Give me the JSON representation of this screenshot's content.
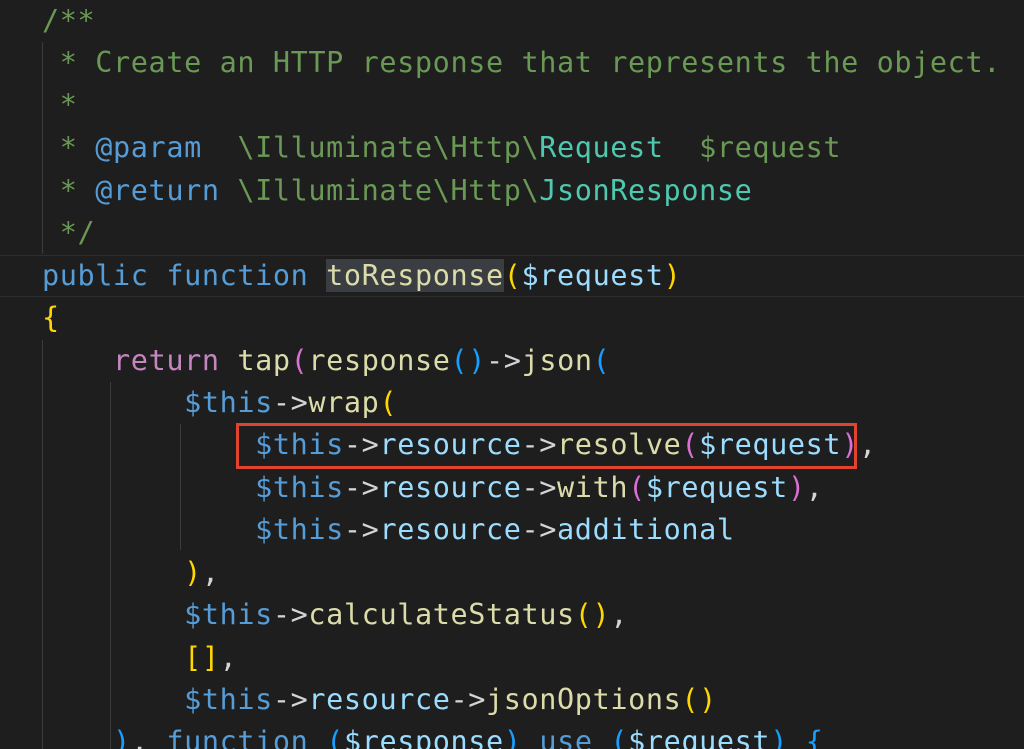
{
  "code": {
    "doc_open": "/**",
    "doc_line1": " * Create an HTTP response that represents the object.",
    "doc_star": " *",
    "doc_param_star": " * ",
    "doc_param_tag": "@param",
    "doc_param_ns": "  \\Illuminate\\Http\\",
    "doc_param_class": "Request",
    "doc_param_var": "  $request",
    "doc_return_star": " * ",
    "doc_return_tag": "@return",
    "doc_return_ns": " \\Illuminate\\Http\\",
    "doc_return_class": "JsonResponse",
    "doc_close": " */",
    "kw_public": "public",
    "kw_function": "function",
    "fn_toResponse": "toResponse",
    "var_request": "$request",
    "brace_open": "{",
    "kw_return": "return",
    "fn_tap": "tap",
    "fn_response": "response",
    "arrow": "->",
    "fn_json": "json",
    "this": "$this",
    "fn_wrap": "wrap",
    "prop_resource": "resource",
    "fn_resolve": "resolve",
    "fn_with": "with",
    "prop_additional": "additional",
    "fn_calculateStatus": "calculateStatus",
    "empty_array": "[]",
    "fn_jsonOptions": "jsonOptions",
    "kw_use": "use",
    "var_response": "$response"
  },
  "colors": {
    "background": "#1e1e1e",
    "comment": "#6a9955",
    "keyword": "#569cd6",
    "control": "#c586c0",
    "function": "#dcdcaa",
    "variable": "#9cdcfe",
    "type": "#4ec9b0",
    "highlight_box": "#e0442e"
  }
}
